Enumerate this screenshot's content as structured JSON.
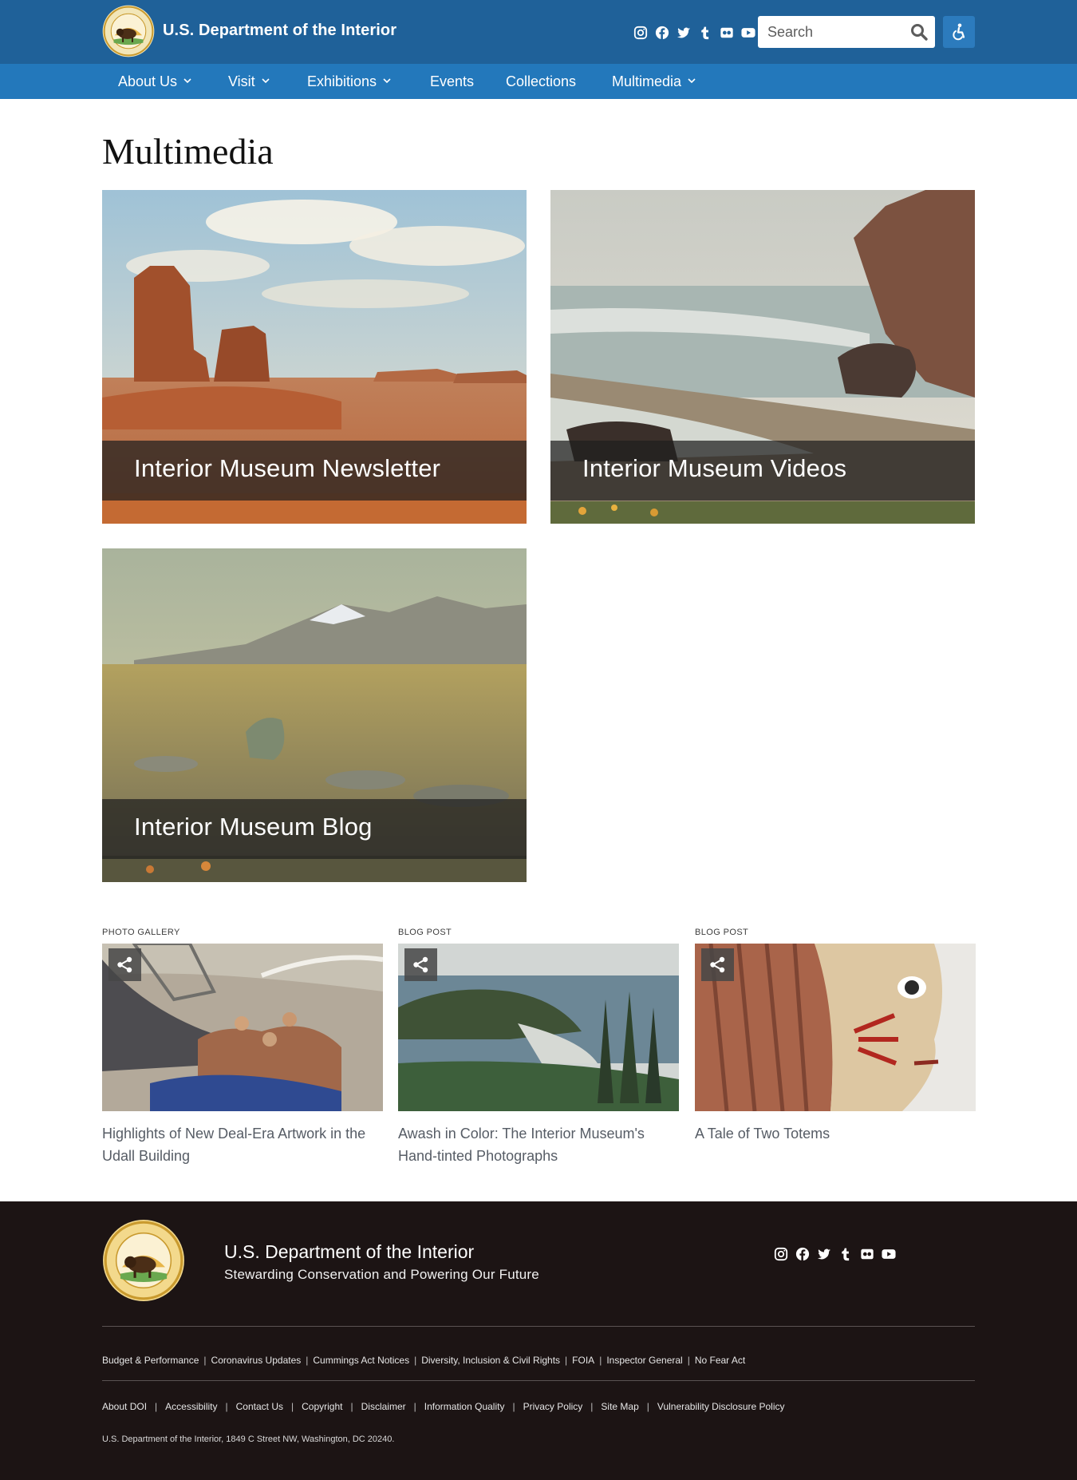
{
  "header": {
    "site_title": "U.S. Department of the Interior",
    "search_placeholder": "Search",
    "social_icons": [
      "instagram-icon",
      "facebook-icon",
      "twitter-icon",
      "tumblr-icon",
      "flickr-icon",
      "youtube-icon"
    ],
    "colors": {
      "topbar": "#1f6199",
      "navbar": "#2378bb",
      "accessibility_button": "#2c7bbd"
    }
  },
  "nav": {
    "items": [
      {
        "label": "About Us",
        "has_dropdown": true
      },
      {
        "label": "Visit",
        "has_dropdown": true
      },
      {
        "label": "Exhibitions",
        "has_dropdown": true
      },
      {
        "label": "Events",
        "has_dropdown": false
      },
      {
        "label": "Collections",
        "has_dropdown": false
      },
      {
        "label": "Multimedia",
        "has_dropdown": true
      }
    ]
  },
  "main": {
    "page_title": "Multimedia",
    "cards": [
      {
        "label": "Interior Museum Newsletter"
      },
      {
        "label": "Interior Museum Videos"
      },
      {
        "label": "Interior Museum Blog"
      }
    ],
    "teasers": [
      {
        "kind": "PHOTO GALLERY",
        "title": "Highlights of New Deal-Era Artwork in the Udall Building"
      },
      {
        "kind": "BLOG POST",
        "title": "Awash in Color: The Interior Museum's Hand-tinted Photographs"
      },
      {
        "kind": "BLOG POST",
        "title": "A Tale of Two Totems"
      }
    ]
  },
  "footer": {
    "org_name": "U.S. Department of the Interior",
    "tagline": "Stewarding Conservation and Powering Our Future",
    "links_row1": [
      "Budget & Performance",
      "Coronavirus Updates",
      "Cummings Act Notices",
      "Diversity, Inclusion & Civil Rights",
      "FOIA",
      "Inspector General",
      "No Fear Act"
    ],
    "links_row2": [
      "About DOI",
      "Accessibility",
      "Contact Us",
      "Copyright",
      "Disclaimer",
      "Information Quality",
      "Privacy Policy",
      "Site Map",
      "Vulnerability Disclosure Policy"
    ],
    "address": "U.S. Department of the Interior, 1849 C Street NW, Washington, DC 20240.",
    "separator": "|",
    "background": "#1c1414"
  }
}
